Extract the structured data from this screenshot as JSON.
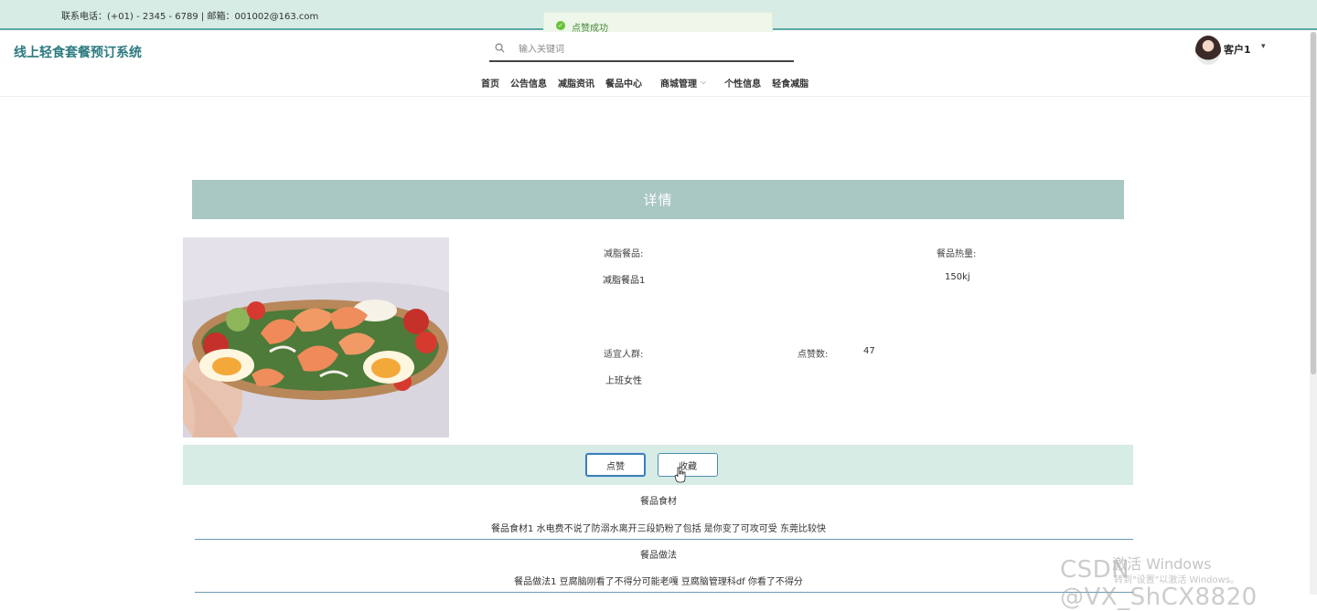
{
  "topbar": {
    "contact": "联系电话：(+01) - 2345 - 6789 | 邮箱：001002@163.com"
  },
  "toast": {
    "message": "点赞成功",
    "icon": "check-circle-icon"
  },
  "header": {
    "brand": "线上轻食套餐预订系统",
    "search_placeholder": "输入关键词",
    "user_name": "客户1",
    "user_caret": "▾"
  },
  "nav": {
    "items": [
      {
        "label": "首页"
      },
      {
        "label": "公告信息"
      },
      {
        "label": "减脂资讯"
      },
      {
        "label": "餐品中心"
      },
      {
        "label": "商城管理",
        "has_dropdown": true
      },
      {
        "label": "个性信息"
      },
      {
        "label": "轻食减脂"
      }
    ]
  },
  "detail": {
    "title": "详情",
    "fields": {
      "meal_label": "减脂餐品:",
      "meal_value": "减脂餐品1",
      "calories_label": "餐品热量:",
      "calories_value": "150kj",
      "audience_label": "适宜人群:",
      "audience_value": "上班女性",
      "likes_label": "点赞数:",
      "likes_value": "47"
    },
    "buttons": {
      "like": "点赞",
      "favorite": "收藏"
    },
    "ingredients_title": "餐品食材",
    "ingredients_text": "餐品食材1 水电费不说了防溺水离开三段奶粉了包括 是你变了可攻可受 东莞比较快",
    "method_title": "餐品做法",
    "method_text": "餐品做法1 豆腐脑刚看了不得分可能老嘎 豆腐脑管理科df 你看了不得分"
  },
  "overlay": {
    "activate_windows": "激活 Windows",
    "activate_hint": "转到\"设置\"以激活 Windows。",
    "csdn_watermark": "CSDN @VX_ShCX8820"
  },
  "colors": {
    "topbar_bg": "#d6ece4",
    "brand": "#2b7a80",
    "detail_bar": "#a9c7c3",
    "button_border": "#4d8fb0",
    "toast_icon": "#67c23a"
  }
}
